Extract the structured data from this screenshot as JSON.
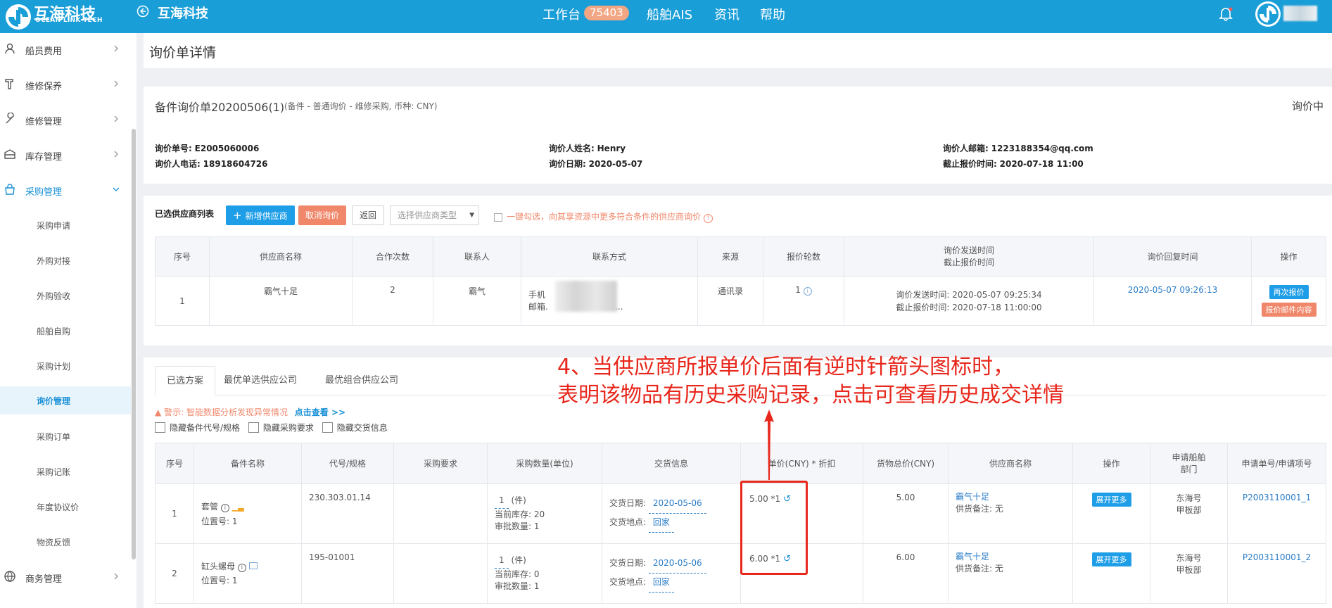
{
  "topbar": {
    "brand": "互海科技",
    "brand_sub": "OCEAN LINK TECH",
    "company": "互海科技",
    "nav_workbench": "工作台",
    "badge_count": "75403",
    "nav_ais": "船舶AIS",
    "nav_news": "资讯",
    "nav_help": "帮助",
    "colors": {
      "bar": "#199ed8",
      "badge": "#f3a683"
    }
  },
  "sidebar": {
    "items": [
      {
        "label": "船员费用",
        "icon": "person-icon"
      },
      {
        "label": "维修保养",
        "icon": "tool-icon"
      },
      {
        "label": "维修管理",
        "icon": "wrench-icon"
      },
      {
        "label": "库存管理",
        "icon": "box-icon"
      },
      {
        "label": "采购管理",
        "icon": "cart-icon",
        "expanded": true
      }
    ],
    "sub_items": [
      "采购申请",
      "外购对接",
      "外购验收",
      "船舶自购",
      "采购计划",
      "询价管理",
      "采购订单",
      "采购记账",
      "年度协议价",
      "物资反馈"
    ],
    "active_sub": "询价管理",
    "bottom_item": "商务管理"
  },
  "page": {
    "title": "询价单详情"
  },
  "inquiry": {
    "name": "备件询价单20200506(1)",
    "meta": "(备件 - 普通询价 - 维修采购, 币种: CNY)",
    "status": "询价中",
    "no_label": "询价单号:",
    "no": "E2005060006",
    "phone_label": "询价人电话:",
    "phone": "18918604726",
    "person_label": "询价人姓名:",
    "person": "Henry",
    "date_label": "询价日期:",
    "date": "2020-05-07",
    "email_label": "询价人邮箱:",
    "email": "1223188354@qq.com",
    "deadline_label": "截止报价时间:",
    "deadline": "2020-07-18 11:00"
  },
  "suppliers": {
    "title": "已选供应商列表",
    "add_btn": "新增供应商",
    "cancel_btn": "取消询价",
    "back_btn": "返回",
    "type_select": "选择供应商类型",
    "one_click": "一键勾选，向其享资源中更多符合条件的供应商询价",
    "headers": [
      "序号",
      "供应商名称",
      "合作次数",
      "联系人",
      "联系方式",
      "来源",
      "报价轮数",
      "询价发送时间",
      "截止报价时间",
      "询价回复时间",
      "操作"
    ],
    "row": {
      "no": "1",
      "name": "霸气十足",
      "count": "2",
      "contact": "霸气",
      "phone_label": "手机",
      "mail_label": "邮箱.",
      "mail_tail": "..4...",
      "source": "通讯录",
      "rounds": "1",
      "send_time": "询价发送时间: 2020-05-07 09:25:34",
      "deadline_time": "截止报价时间: 2020-07-18 11:00:00",
      "reply_time": "2020-05-07 09:26:13",
      "requote_btn": "再次报价",
      "mail_btn": "报价邮件内容"
    }
  },
  "plan": {
    "tabs": [
      "已选方案",
      "最优单选供应公司",
      "最优组合供应公司"
    ],
    "warning_label": "警示:",
    "warning_text": "智能数据分析发现异常情况",
    "warning_link": "点击查看 >>",
    "checks": [
      "隐藏备件代号/规格",
      "隐藏采购要求",
      "隐藏交货信息"
    ],
    "headers": [
      "序号",
      "备件名称",
      "代号/规格",
      "采购要求",
      "采购数量(单位)",
      "交货信息",
      "单价(CNY) * 折扣",
      "货物总价(CNY)",
      "供应商名称",
      "操作",
      "申请船舶",
      "部门",
      "申请单号/申请项号"
    ],
    "rows": [
      {
        "no": "1",
        "name": "套管",
        "pos": "位置号: 1",
        "code": "230.303.01.14",
        "qty": "1",
        "unit": "(件)",
        "stock": "当前库存: 20",
        "approve": "审批数量: 1",
        "date_label": "交货日期:",
        "date": "2020-05-06",
        "place_label": "交货地点:",
        "place": "回家",
        "price": "5.00 *1",
        "total": "5.00",
        "supplier": "霸气十足",
        "remark": "供货备注: 无",
        "op": "展开更多",
        "ship": "东海号",
        "dept": "甲板部",
        "apply_no": "P2003110001_1"
      },
      {
        "no": "2",
        "name": "缸头螺母",
        "pos": "位置号: 1",
        "code": "195-01001",
        "qty": "1",
        "unit": "(件)",
        "stock": "当前库存: 0",
        "approve": "审批数量: 1",
        "date_label": "交货日期:",
        "date": "2020-05-06",
        "place_label": "交货地点:",
        "place": "回家",
        "price": "6.00 *1",
        "total": "6.00",
        "supplier": "霸气十足",
        "remark": "供货备注: 无",
        "op": "展开更多",
        "ship": "东海号",
        "dept": "甲板部",
        "apply_no": "P2003110001_2"
      }
    ]
  },
  "annotation": {
    "line1": "4、当供应商所报单价后面有逆时针箭头图标时，",
    "line2": "表明该物品有历史采购记录，点击可查看历史成交详情",
    "color": "#e8271c"
  }
}
